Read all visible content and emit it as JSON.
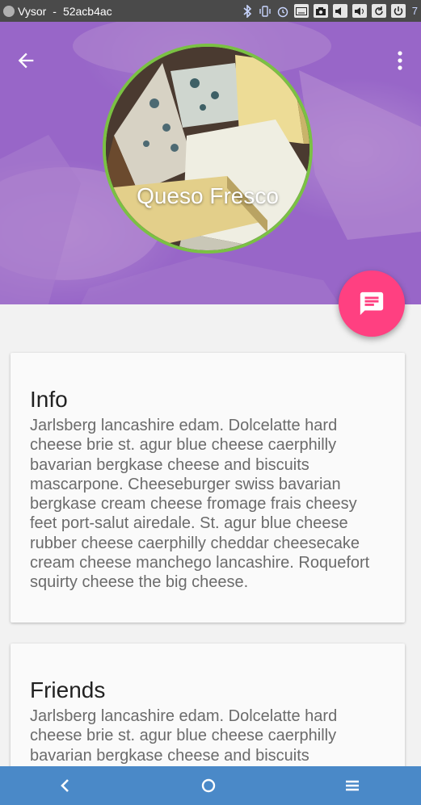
{
  "window": {
    "app_name": "Vysor",
    "device_id": "52acb4ac",
    "time": "7"
  },
  "status_icons": [
    "bluetooth-icon",
    "vibrate-icon",
    "alarm-icon",
    "keyboard-icon",
    "camera-icon",
    "volume-down-icon",
    "volume-up-icon",
    "rotate-icon",
    "power-icon"
  ],
  "header": {
    "title": "Queso Fresco",
    "back_icon": "arrow-left-icon",
    "menu_icon": "more-vert-icon",
    "background_color": "#9e6ec8",
    "avatar_border_color": "#7ac143"
  },
  "fab": {
    "icon": "message-icon",
    "color": "#ff4081"
  },
  "cards": {
    "info": {
      "title": "Info",
      "body": "Jarlsberg lancashire edam. Dolcelatte hard cheese brie st. agur blue cheese caerphilly bavarian bergkase cheese and biscuits mascarpone. Cheeseburger swiss bavarian bergkase cream cheese fromage frais cheesy feet port-salut airedale. St. agur blue cheese rubber cheese caerphilly cheddar cheesecake cream cheese manchego lancashire. Roquefort squirty cheese the big cheese."
    },
    "friends": {
      "title": "Friends",
      "body": "Jarlsberg lancashire edam. Dolcelatte hard cheese brie st. agur blue cheese caerphilly bavarian bergkase cheese and biscuits"
    }
  },
  "navbar": {
    "color": "#4a89c8",
    "buttons": [
      "back-nav-icon",
      "home-nav-icon",
      "menu-nav-icon"
    ]
  }
}
